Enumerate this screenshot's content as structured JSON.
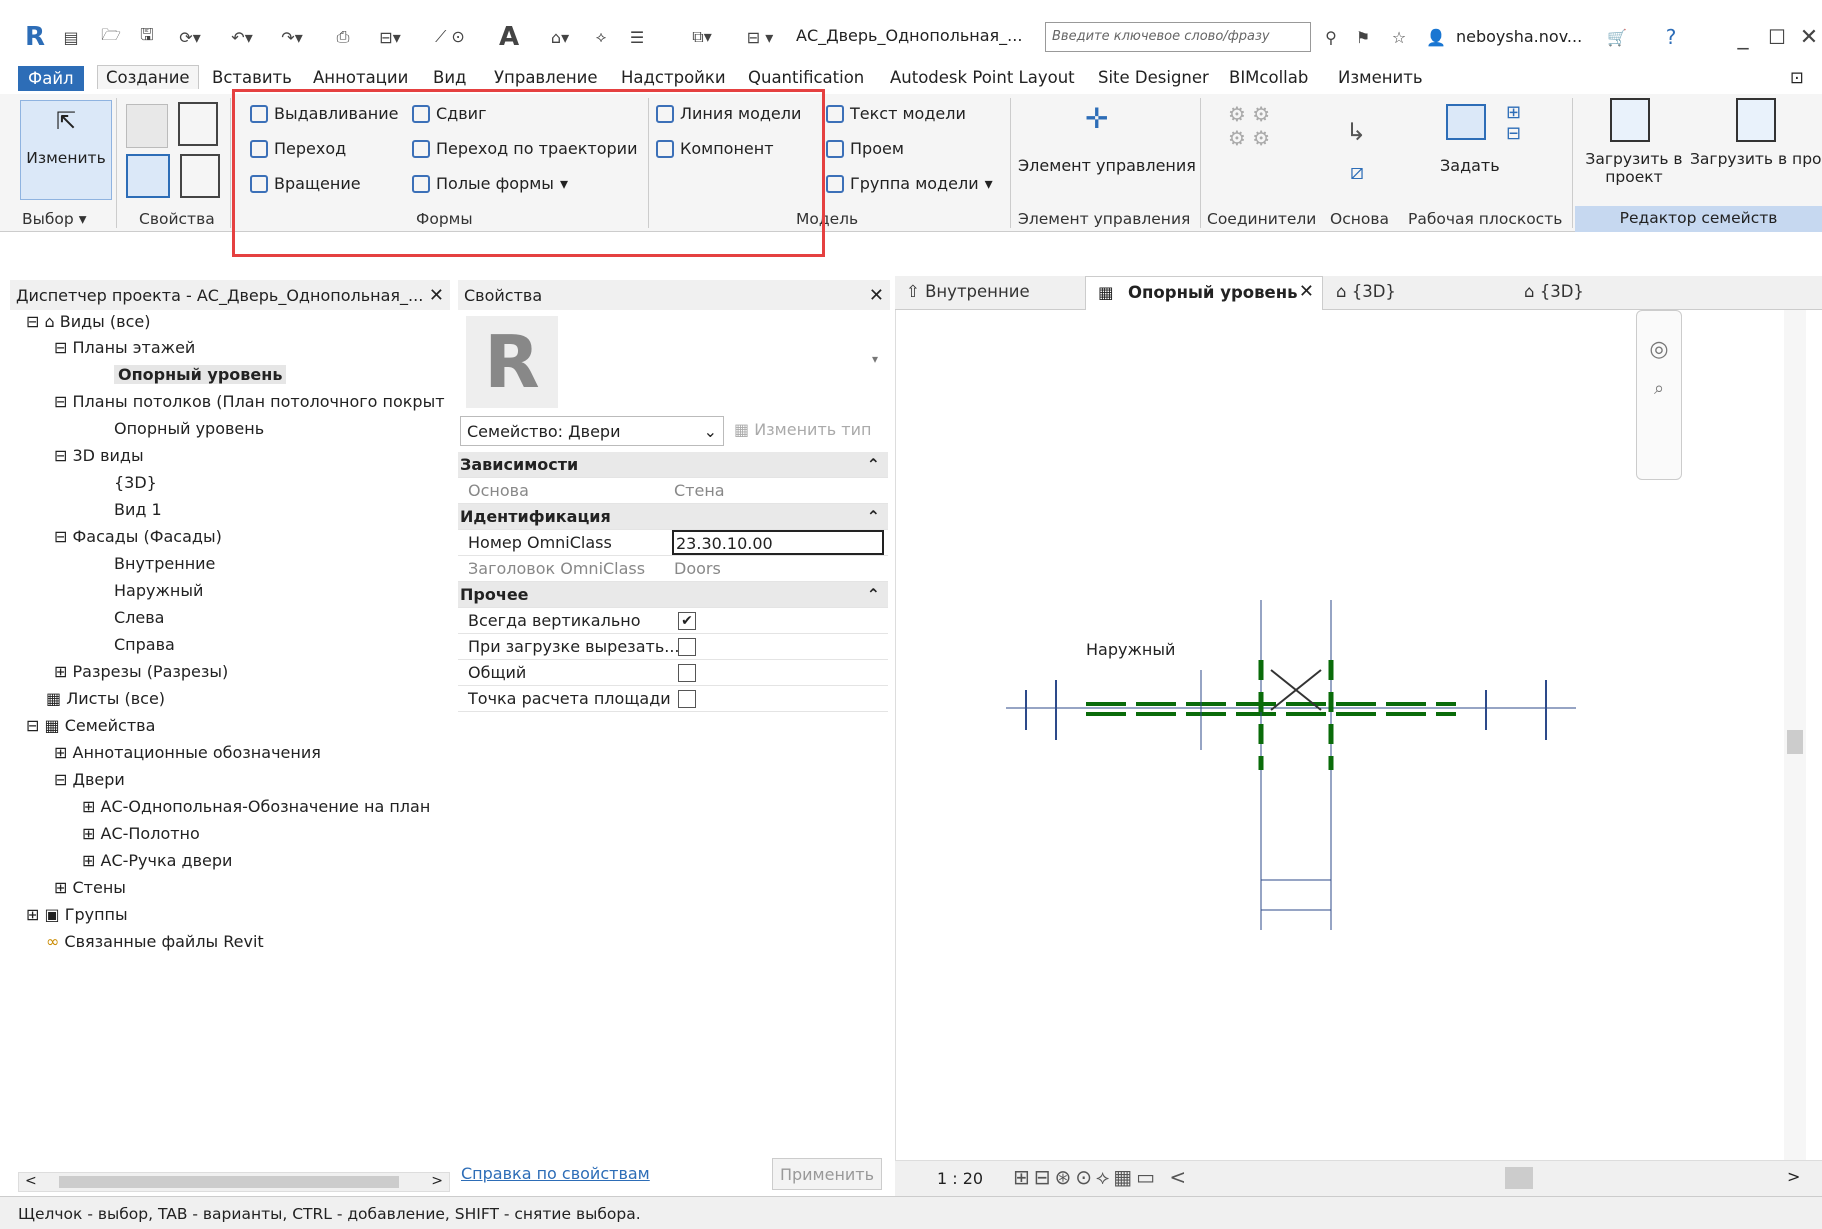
{
  "qat": {
    "doc_title": "АС_Дверь_Однопольная_...",
    "search_placeholder": "Введите ключевое слово/фразу",
    "user": "neboysha.nov...",
    "help": "?"
  },
  "menu": [
    "Файл",
    "Создание",
    "Вставить",
    "Аннотации",
    "Вид",
    "Управление",
    "Надстройки",
    "Quantification",
    "Autodesk Point Layout",
    "Site Designer",
    "BIMcollab",
    "Изменить"
  ],
  "ribbon": {
    "modify": "Изменить",
    "select": "Выбор",
    "properties": "Свойства",
    "forms": [
      "Выдавливание",
      "Переход",
      "Вращение",
      "Сдвиг",
      "Переход по траектории",
      "Полые формы"
    ],
    "forms_label": "Формы",
    "model_items": [
      "Линия модели",
      "Компонент",
      "Текст модели",
      "Проем",
      "Группа модели"
    ],
    "model_label": "Модель",
    "control": "Элемент управления",
    "control_label": "Элемент управления",
    "connectors": "Соединители",
    "datum": "Основа",
    "set": "Задать",
    "workplane": "Рабочая плоскость",
    "load1": "Загрузить в проект",
    "load2": "Загрузить в проект и закрыть",
    "family_editor": "Редактор семейств"
  },
  "browser": {
    "title": "Диспетчер проекта - АС_Дверь_Однопольная_...",
    "items": [
      "Виды (все)",
      "Планы этажей",
      "Опорный уровень",
      "Планы потолков (План потолочного покрыт",
      "Опорный уровень",
      "3D виды",
      "{3D}",
      "Вид 1",
      "Фасады (Фасады)",
      "Внутренние",
      "Наружный",
      "Слева",
      "Справа",
      "Разрезы (Разрезы)",
      "Листы (все)",
      "Семейства",
      "Аннотационные обозначения",
      "Двери",
      "АС-Однопольная-Обозначение на план",
      "АС-Полотно",
      "АС-Ручка двери",
      "Стены",
      "Группы",
      "Связанные файлы Revit"
    ]
  },
  "properties": {
    "title": "Свойства",
    "family": "Семейство: Двери",
    "edit_type": "Изменить тип",
    "sec1": "Зависимости",
    "host_label": "Основа",
    "host_value": "Стена",
    "sec2": "Идентификация",
    "omni_num_label": "Номер OmniClass",
    "omni_num_value": "23.30.10.00",
    "omni_title_label": "Заголовок OmniClass",
    "omni_title_value": "Doors",
    "sec3": "Прочее",
    "vert": "Всегда вертикально",
    "cut": "При загрузке вырезать...",
    "shared": "Общий",
    "area": "Точка расчета площади",
    "help": "Справка по свойствам",
    "apply": "Применить"
  },
  "tabs": [
    "Внутренние",
    "Опорный уровень",
    "{3D}",
    "{3D}"
  ],
  "canvas": {
    "label": "Наружный",
    "scale": "1 : 20"
  },
  "status": "Щелчок - выбор, TAB - варианты, CTRL - добавление, SHIFT - снятие выбора."
}
